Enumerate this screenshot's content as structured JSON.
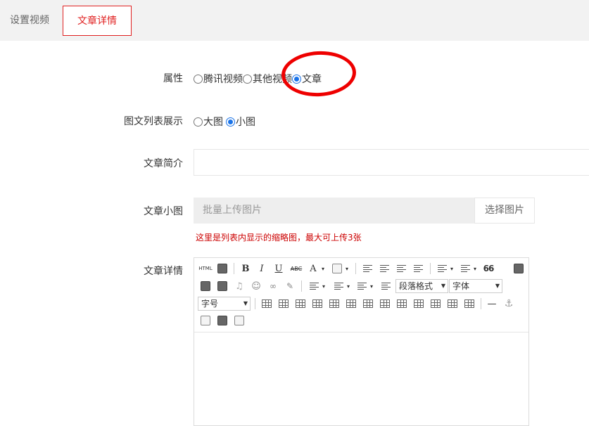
{
  "tabs": [
    {
      "label": "设置视频"
    },
    {
      "label": "文章详情"
    }
  ],
  "form": {
    "attr_label": "属性",
    "attr_options": [
      "腾讯视频",
      "其他视频",
      "文章"
    ],
    "attr_selected": "文章",
    "list_label": "图文列表展示",
    "list_options": [
      "大图",
      "小图"
    ],
    "list_selected": "小图",
    "intro_label": "文章简介",
    "intro_value": "",
    "thumb_label": "文章小图",
    "upload_label": "批量上传图片",
    "choose_label": "选择图片",
    "hint": "这里是列表内显示的缩略图，最大可上传3张",
    "detail_label": "文章详情"
  },
  "editor": {
    "html_btn": "HTML",
    "bold": "B",
    "italic": "I",
    "underline": "U",
    "strike": "ABC",
    "fontcolor": "A",
    "quote": "66",
    "paragraph_select": "段落格式",
    "font_select": "字体",
    "size_select": "字号"
  },
  "colors": {
    "accent": "#e02020",
    "radio": "#1a73e8",
    "hint": "#cc0000",
    "annotation_circle": "#ee0000"
  }
}
